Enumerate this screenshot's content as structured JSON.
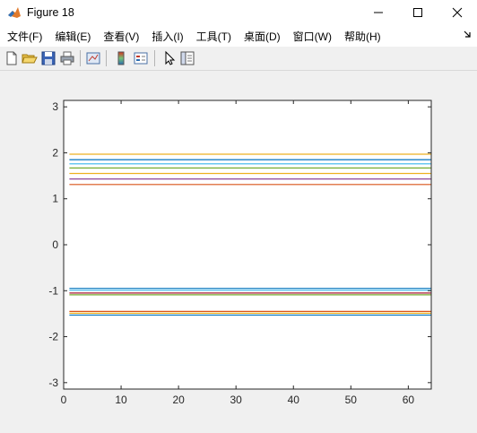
{
  "window": {
    "title": "Figure 18"
  },
  "menu": [
    "文件(F)",
    "编辑(E)",
    "查看(V)",
    "插入(I)",
    "工具(T)",
    "桌面(D)",
    "窗口(W)",
    "帮助(H)"
  ],
  "toolbar": {
    "buttons": [
      "new-figure-icon",
      "open-file-icon",
      "save-icon",
      "print-icon",
      "link-plot-icon",
      "colorbar-icon",
      "legend-icon",
      "edit-plot-arrow-icon",
      "property-inspector-icon"
    ]
  },
  "chart_data": {
    "type": "line",
    "xlim": [
      0,
      64
    ],
    "ylim": [
      -3.14,
      3.14
    ],
    "x_ticks": [
      0,
      10,
      20,
      30,
      40,
      50,
      60
    ],
    "y_ticks": [
      3,
      2,
      1,
      0,
      -1,
      -2,
      -3
    ],
    "x_range": [
      1,
      64
    ],
    "title": "",
    "xlabel": "",
    "ylabel": "",
    "grid": false,
    "series": [
      {
        "y": 1.97,
        "color": "#edb120"
      },
      {
        "y": 1.85,
        "color": "#0072bd"
      },
      {
        "y": 1.76,
        "color": "#4dbeee"
      },
      {
        "y": 1.67,
        "color": "#77ac30"
      },
      {
        "y": 1.55,
        "color": "#edb120"
      },
      {
        "y": 1.43,
        "color": "#7e2f8e"
      },
      {
        "y": 1.31,
        "color": "#d95319"
      },
      {
        "y": -0.95,
        "color": "#0072bd"
      },
      {
        "y": -0.99,
        "color": "#4dbeee"
      },
      {
        "y": -1.05,
        "color": "#a2142f"
      },
      {
        "y": -1.09,
        "color": "#77ac30"
      },
      {
        "y": -1.45,
        "color": "#d95319"
      },
      {
        "y": -1.49,
        "color": "#edb120"
      },
      {
        "y": -1.53,
        "color": "#0072bd"
      }
    ]
  }
}
